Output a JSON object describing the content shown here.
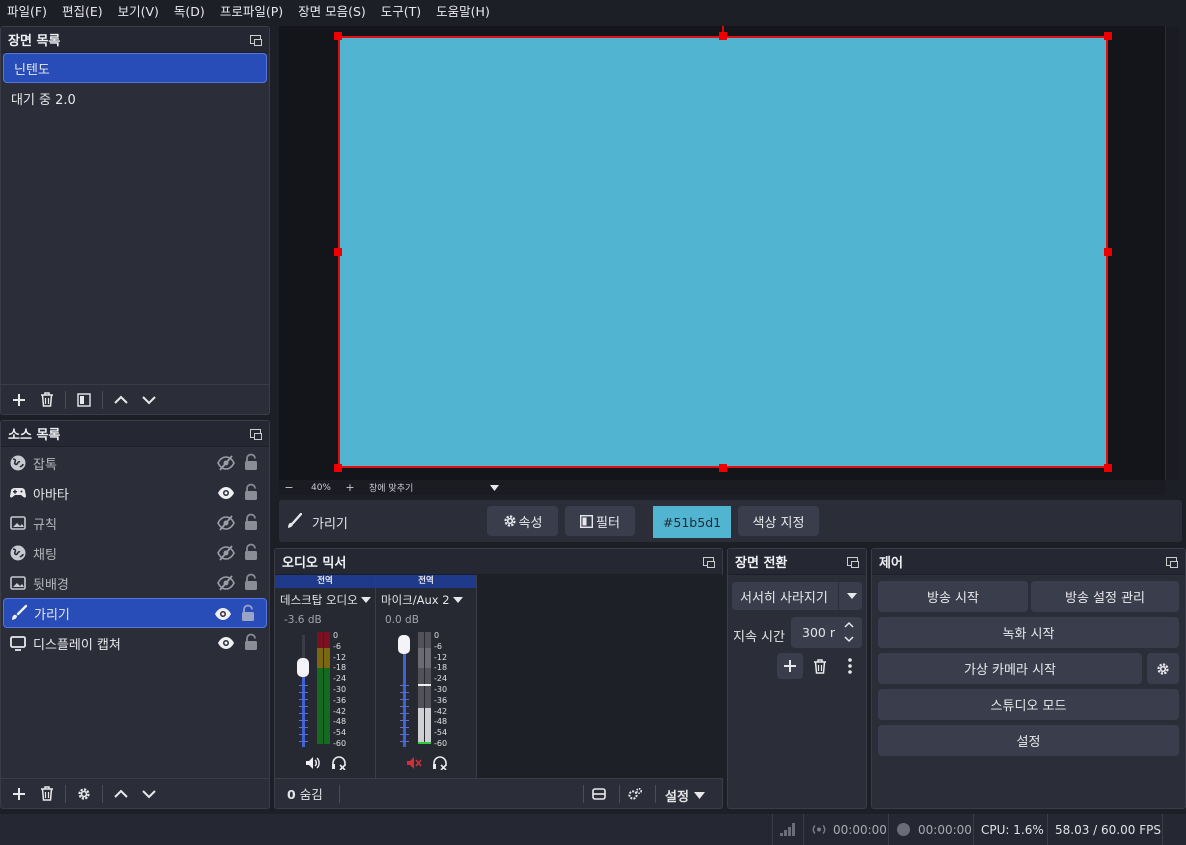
{
  "menu": [
    "파일(F)",
    "편집(E)",
    "보기(V)",
    "독(D)",
    "프로파일(P)",
    "장면 모음(S)",
    "도구(T)",
    "도움말(H)"
  ],
  "scenes": {
    "title": "장면 목록",
    "items": [
      "닌텐도",
      "대기 중 2.0"
    ],
    "selected": 0
  },
  "sources": {
    "title": "소스 목록",
    "items": [
      {
        "label": "잡톡",
        "icon": "globe-icon",
        "visible": false
      },
      {
        "label": "아바타",
        "icon": "gamepad-icon",
        "visible": true
      },
      {
        "label": "규칙",
        "icon": "image-icon",
        "visible": false
      },
      {
        "label": "채팅",
        "icon": "globe-icon",
        "visible": false
      },
      {
        "label": "뒷배경",
        "icon": "image-icon",
        "visible": false
      },
      {
        "label": "가리기",
        "icon": "brush-icon",
        "visible": true,
        "selected": true
      },
      {
        "label": "디스플레이 캡쳐",
        "icon": "monitor-icon",
        "visible": true
      }
    ]
  },
  "preview": {
    "color": "#51b5d1",
    "zoom": "40%",
    "zoom_minus": "−",
    "zoom_plus": "+",
    "fit_label": "창에 맞추기"
  },
  "context_bar": {
    "source_name": "가리기",
    "properties_label": "속성",
    "filters_label": "필터",
    "color_value": "#51b5d1",
    "set_color_label": "색상 지정"
  },
  "mixer": {
    "title": "오디오 믹서",
    "channels": [
      {
        "header": "전역",
        "name": "데스크탑 오디오",
        "db": "-3.6 dB",
        "muted": false,
        "level": 0.75
      },
      {
        "header": "전역",
        "name": "마이크/Aux 2",
        "db": "0.0 dB",
        "muted": true,
        "level": 1.0
      }
    ],
    "scale": [
      "0",
      "-6",
      "-12",
      "-18",
      "-24",
      "-30",
      "-36",
      "-42",
      "-48",
      "-54",
      "-60"
    ],
    "hidden_count": "0",
    "hidden_label": "숨김",
    "settings_label": "설정"
  },
  "transitions": {
    "title": "장면 전환",
    "selected": "서서히 사라지기",
    "duration_label": "지속 시간",
    "duration_value": "300 r"
  },
  "controls": {
    "title": "제어",
    "start_stream": "방송 시작",
    "stream_settings": "방송 설정 관리",
    "start_record": "녹화 시작",
    "start_vcam": "가상 카메라 시작",
    "studio_mode": "스튜디오 모드",
    "settings": "설정"
  },
  "status": {
    "stream_time": "00:00:00",
    "record_time": "00:00:00",
    "cpu": "CPU: 1.6%",
    "fps": "58.03 / 60.00 FPS"
  },
  "colors": {
    "accent": "#284cb8",
    "preview_border": "#e01010",
    "meter_green": "#1fa830",
    "meter_yellow": "#c9b400",
    "meter_red": "#c01828"
  }
}
